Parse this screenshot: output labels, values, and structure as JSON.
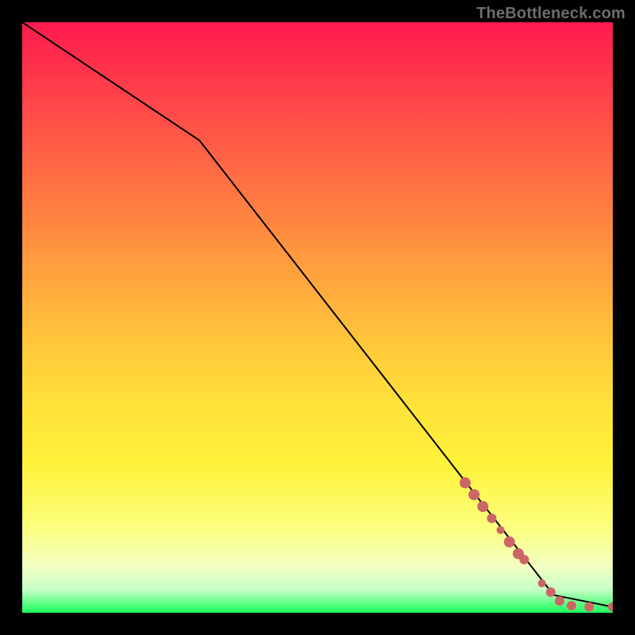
{
  "watermark": "TheBottleneck.com",
  "chart_data": {
    "type": "line",
    "title": "",
    "xlabel": "",
    "ylabel": "",
    "xlim": [
      0,
      100
    ],
    "ylim": [
      0,
      100
    ],
    "grid": false,
    "series": [
      {
        "name": "curve",
        "x": [
          0,
          30,
          90,
          100
        ],
        "y": [
          100,
          80,
          3,
          1
        ],
        "style": "black-line"
      }
    ],
    "markers": {
      "name": "highlight-points",
      "color": "#cc6666",
      "radius_min": 4,
      "radius_max": 8,
      "points": [
        {
          "x": 75,
          "y": 22,
          "r": 7
        },
        {
          "x": 76.5,
          "y": 20,
          "r": 7
        },
        {
          "x": 78,
          "y": 18,
          "r": 7
        },
        {
          "x": 79.5,
          "y": 16,
          "r": 6
        },
        {
          "x": 81,
          "y": 14,
          "r": 5
        },
        {
          "x": 82.5,
          "y": 12,
          "r": 7
        },
        {
          "x": 84,
          "y": 10,
          "r": 7
        },
        {
          "x": 85,
          "y": 9,
          "r": 6
        },
        {
          "x": 88,
          "y": 5,
          "r": 5
        },
        {
          "x": 89.5,
          "y": 3.5,
          "r": 6
        },
        {
          "x": 91,
          "y": 2,
          "r": 6
        },
        {
          "x": 93,
          "y": 1.2,
          "r": 6
        },
        {
          "x": 96,
          "y": 1,
          "r": 6
        },
        {
          "x": 100,
          "y": 1,
          "r": 6
        }
      ]
    }
  }
}
